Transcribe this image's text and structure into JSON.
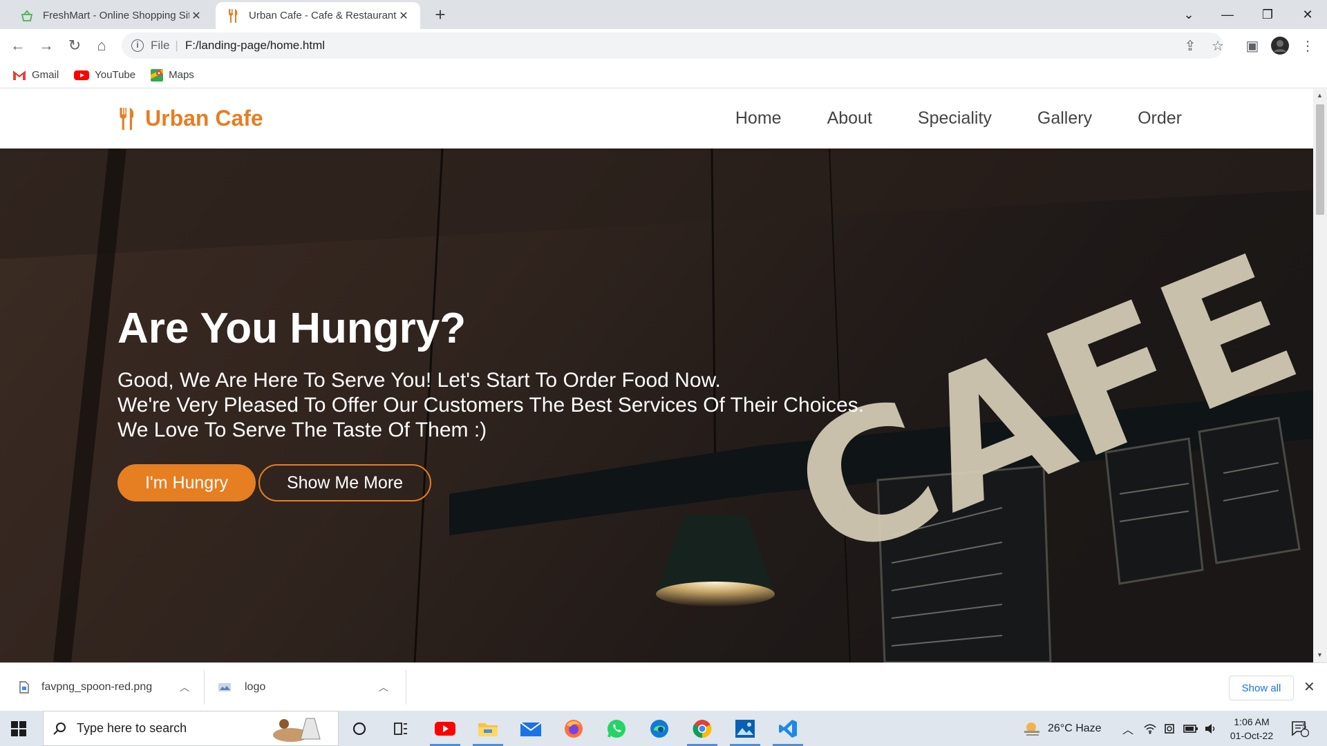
{
  "browser": {
    "tabs": [
      {
        "title": "FreshMart - Online Shopping Site",
        "icon": "basket-icon",
        "active": false
      },
      {
        "title": "Urban Cafe - Cafe & Restaurant",
        "icon": "fork-knife-icon",
        "active": true
      }
    ],
    "url_scheme": "File",
    "url": "F:/landing-page/home.html",
    "bookmarks": [
      {
        "label": "Gmail",
        "icon": "gmail-icon"
      },
      {
        "label": "YouTube",
        "icon": "youtube-icon"
      },
      {
        "label": "Maps",
        "icon": "maps-icon"
      }
    ]
  },
  "site": {
    "brand": "Urban Cafe",
    "accent_color": "#e67e22",
    "nav": [
      "Home",
      "About",
      "Speciality",
      "Gallery",
      "Order"
    ],
    "hero": {
      "title": "Are You Hungry?",
      "lines": [
        "Good, We Are Here To Serve You! Let's Start To Order Food Now.",
        "We're Very Pleased To Offer Our Customers The Best Services Of Their Choices.",
        "We Love To Serve The Taste Of Them :)"
      ],
      "primary_button": "I'm Hungry",
      "secondary_button": "Show Me More",
      "sign_text": "CAFE"
    }
  },
  "downloads": {
    "items": [
      {
        "name": "favpng_spoon-red.png",
        "icon": "file-icon"
      },
      {
        "name": "logo",
        "icon": "image-file-icon"
      }
    ],
    "show_all": "Show all"
  },
  "taskbar": {
    "search_placeholder": "Type here to search",
    "weather": "26°C  Haze",
    "time": "1:06 AM",
    "date": "01-Oct-22",
    "notification_count": "5"
  }
}
